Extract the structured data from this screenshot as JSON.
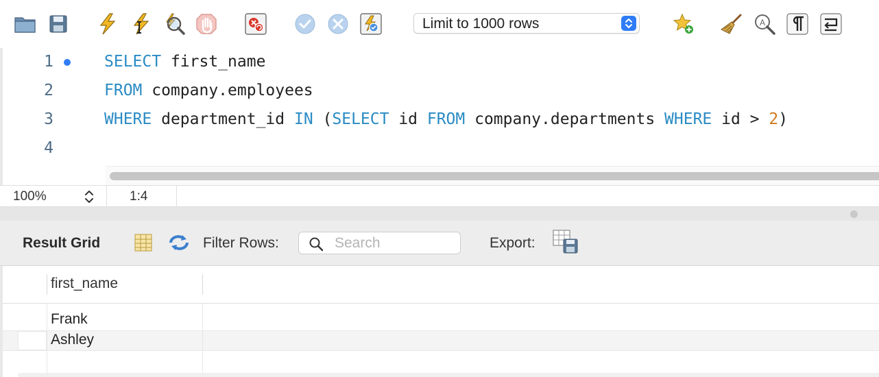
{
  "toolbar": {
    "icons": [
      "open-folder-icon",
      "save-icon",
      "execute-icon",
      "execute-current-icon",
      "explain-icon",
      "stop-icon",
      "stop-on-error-icon",
      "commit-icon",
      "rollback-icon",
      "autocommit-icon",
      "add-snippet-icon",
      "beautify-icon",
      "find-icon",
      "invisible-chars-icon",
      "wrap-lines-icon"
    ],
    "limit_value": "Limit to 1000 rows",
    "limit_options": [
      "Limit to 1000 rows"
    ]
  },
  "editor": {
    "line_numbers": [
      "1",
      "2",
      "3",
      "4"
    ],
    "line1": {
      "kw1": "SELECT",
      "rest": " first_name"
    },
    "line2": {
      "kw1": "FROM",
      "rest": " company.employees"
    },
    "line3": {
      "kw1": "WHERE",
      "t1": " department_id ",
      "kw2": "IN",
      "t2": " (",
      "kw3": "SELECT",
      "t3": " id ",
      "kw4": "FROM",
      "t4": " company.departments ",
      "kw5": "WHERE",
      "t5": " id > ",
      "num": "2",
      "t6": ")"
    },
    "colors": {
      "keyword": "#2a8bc4",
      "number": "#d0791e",
      "marker": "#2f7cf6"
    }
  },
  "statusbar": {
    "zoom": "100%",
    "cursor": "1:4"
  },
  "result": {
    "title": "Result Grid",
    "filter_label": "Filter Rows:",
    "search_placeholder": "Search",
    "search_value": "",
    "export_label": "Export:",
    "columns": [
      "first_name"
    ],
    "rows": [
      [
        "Frank"
      ],
      [
        "Ashley"
      ]
    ]
  }
}
